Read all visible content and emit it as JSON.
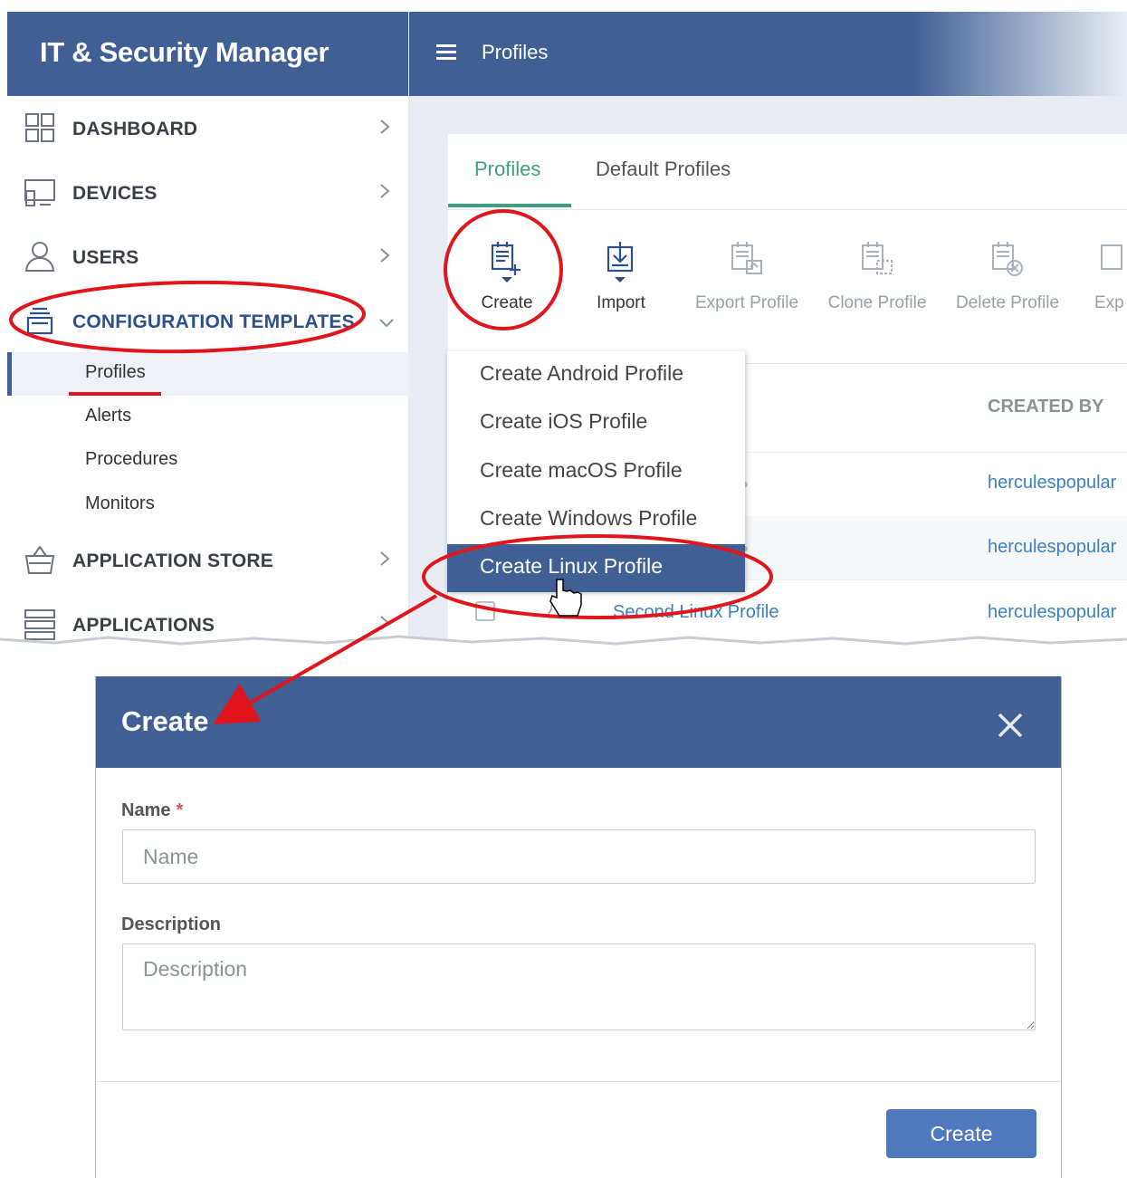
{
  "app": {
    "title": "IT & Security Manager"
  },
  "header": {
    "page_title": "Profiles"
  },
  "sidebar": {
    "items": [
      {
        "label": "DASHBOARD",
        "icon": "dashboard-icon"
      },
      {
        "label": "DEVICES",
        "icon": "devices-icon"
      },
      {
        "label": "USERS",
        "icon": "user-icon"
      },
      {
        "label": "CONFIGURATION TEMPLATES",
        "icon": "templates-icon",
        "expanded": true
      },
      {
        "label": "APPLICATION STORE",
        "icon": "store-icon"
      },
      {
        "label": "APPLICATIONS",
        "icon": "applications-icon"
      }
    ],
    "sub_items": [
      {
        "label": "Profiles",
        "active": true
      },
      {
        "label": "Alerts"
      },
      {
        "label": "Procedures"
      },
      {
        "label": "Monitors"
      }
    ]
  },
  "tabs": [
    {
      "label": "Profiles",
      "active": true
    },
    {
      "label": "Default Profiles"
    }
  ],
  "toolbar": [
    {
      "label": "Create",
      "icon": "create-profile-icon",
      "enabled": true
    },
    {
      "label": "Import",
      "icon": "import-icon",
      "enabled": true
    },
    {
      "label": "Export Profile",
      "icon": "export-profile-icon",
      "enabled": false
    },
    {
      "label": "Clone Profile",
      "icon": "clone-profile-icon",
      "enabled": false
    },
    {
      "label": "Delete Profile",
      "icon": "delete-profile-icon",
      "enabled": false
    },
    {
      "label": "Exp",
      "icon": "export-icon",
      "enabled": false
    }
  ],
  "create_menu": [
    {
      "label": "Create Android Profile"
    },
    {
      "label": "Create iOS Profile"
    },
    {
      "label": "Create macOS Profile"
    },
    {
      "label": "Create Windows Profile"
    },
    {
      "label": "Create Linux Profile",
      "highlighted": true
    }
  ],
  "table": {
    "columns": {
      "created_by": "CREATED BY"
    },
    "rows": [
      {
        "name": "",
        "created_by": "herculespopular"
      },
      {
        "name": "",
        "created_by": "herculespopular"
      },
      {
        "name": "Second Linux Profile",
        "created_by": "herculespopular"
      }
    ]
  },
  "modal": {
    "title": "Create",
    "name_label": "Name",
    "required_mark": "*",
    "name_placeholder": "Name",
    "name_value": "",
    "description_label": "Description",
    "description_placeholder": "Description",
    "description_value": "",
    "submit_label": "Create"
  },
  "colors": {
    "brand": "#3f5f95",
    "accent_tab": "#3d9e82",
    "link": "#3b7fc4",
    "annotation": "#e0161c",
    "primary_button": "#4f78be"
  }
}
